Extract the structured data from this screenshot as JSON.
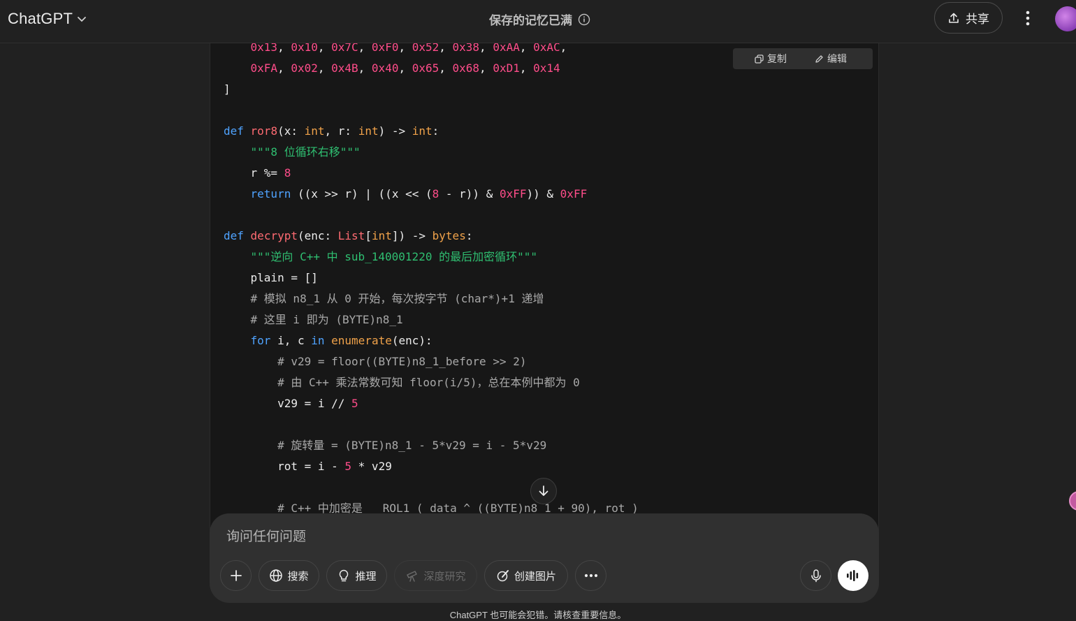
{
  "header": {
    "model_name": "ChatGPT",
    "memory_status": "保存的记忆已满",
    "share_label": "共享"
  },
  "code_block": {
    "copy_label": "复制",
    "edit_label": "编辑"
  },
  "composer": {
    "placeholder": "询问任何问题",
    "search_label": "搜索",
    "reason_label": "推理",
    "deep_research_label": "深度研究",
    "create_image_label": "创建图片"
  },
  "footer": {
    "disclaimer": "ChatGPT 也可能会犯错。请核查重要信息。"
  },
  "colors": {
    "background": "#212121",
    "code_background": "#171717",
    "keyword": "#4fa3ff",
    "function": "#ff6b72",
    "type": "#f0a24a",
    "number": "#ff4d8a",
    "string": "#2fbf71",
    "comment": "#a9a9a9"
  },
  "icons": [
    "chevron-down-icon",
    "info-icon",
    "share-upload-icon",
    "more-vertical-icon",
    "copy-icon",
    "edit-icon",
    "arrow-down-icon",
    "plus-icon",
    "globe-icon",
    "lightbulb-icon",
    "telescope-icon",
    "image-brush-icon",
    "more-horizontal-icon",
    "mic-icon",
    "voice-wave-icon"
  ]
}
